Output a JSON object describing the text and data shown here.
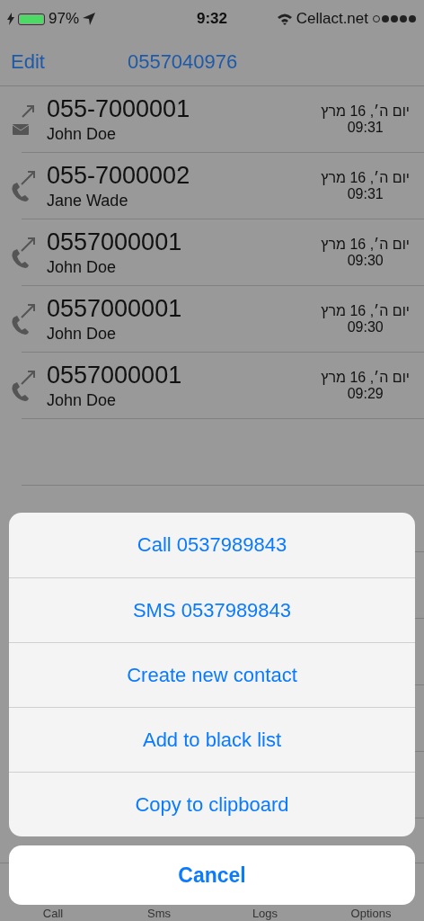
{
  "status_bar": {
    "battery": "97%",
    "time": "9:32",
    "carrier": "Cellact.net"
  },
  "nav": {
    "left": "Edit",
    "title": "0557040976"
  },
  "calls": [
    {
      "kind": "sms",
      "number": "055-7000001",
      "name": "John Doe",
      "date": "יום ה׳, 16 מרץ",
      "time": "09:31"
    },
    {
      "kind": "call",
      "number": "055-7000002",
      "name": "Jane Wade",
      "date": "יום ה׳, 16 מרץ",
      "time": "09:31"
    },
    {
      "kind": "call",
      "number": "0557000001",
      "name": "John Doe",
      "date": "יום ה׳, 16 מרץ",
      "time": "09:30"
    },
    {
      "kind": "call",
      "number": "0557000001",
      "name": "John Doe",
      "date": "יום ה׳, 16 מרץ",
      "time": "09:30"
    },
    {
      "kind": "call",
      "number": "0557000001",
      "name": "John Doe",
      "date": "יום ה׳, 16 מרץ",
      "time": "09:29"
    }
  ],
  "tab_bar": [
    "Call",
    "Sms",
    "Logs",
    "Options"
  ],
  "action_sheet": {
    "actions": [
      "Call 0537989843",
      "SMS 0537989843",
      "Create new contact",
      "Add to black list",
      "Copy to clipboard"
    ],
    "cancel": "Cancel"
  }
}
